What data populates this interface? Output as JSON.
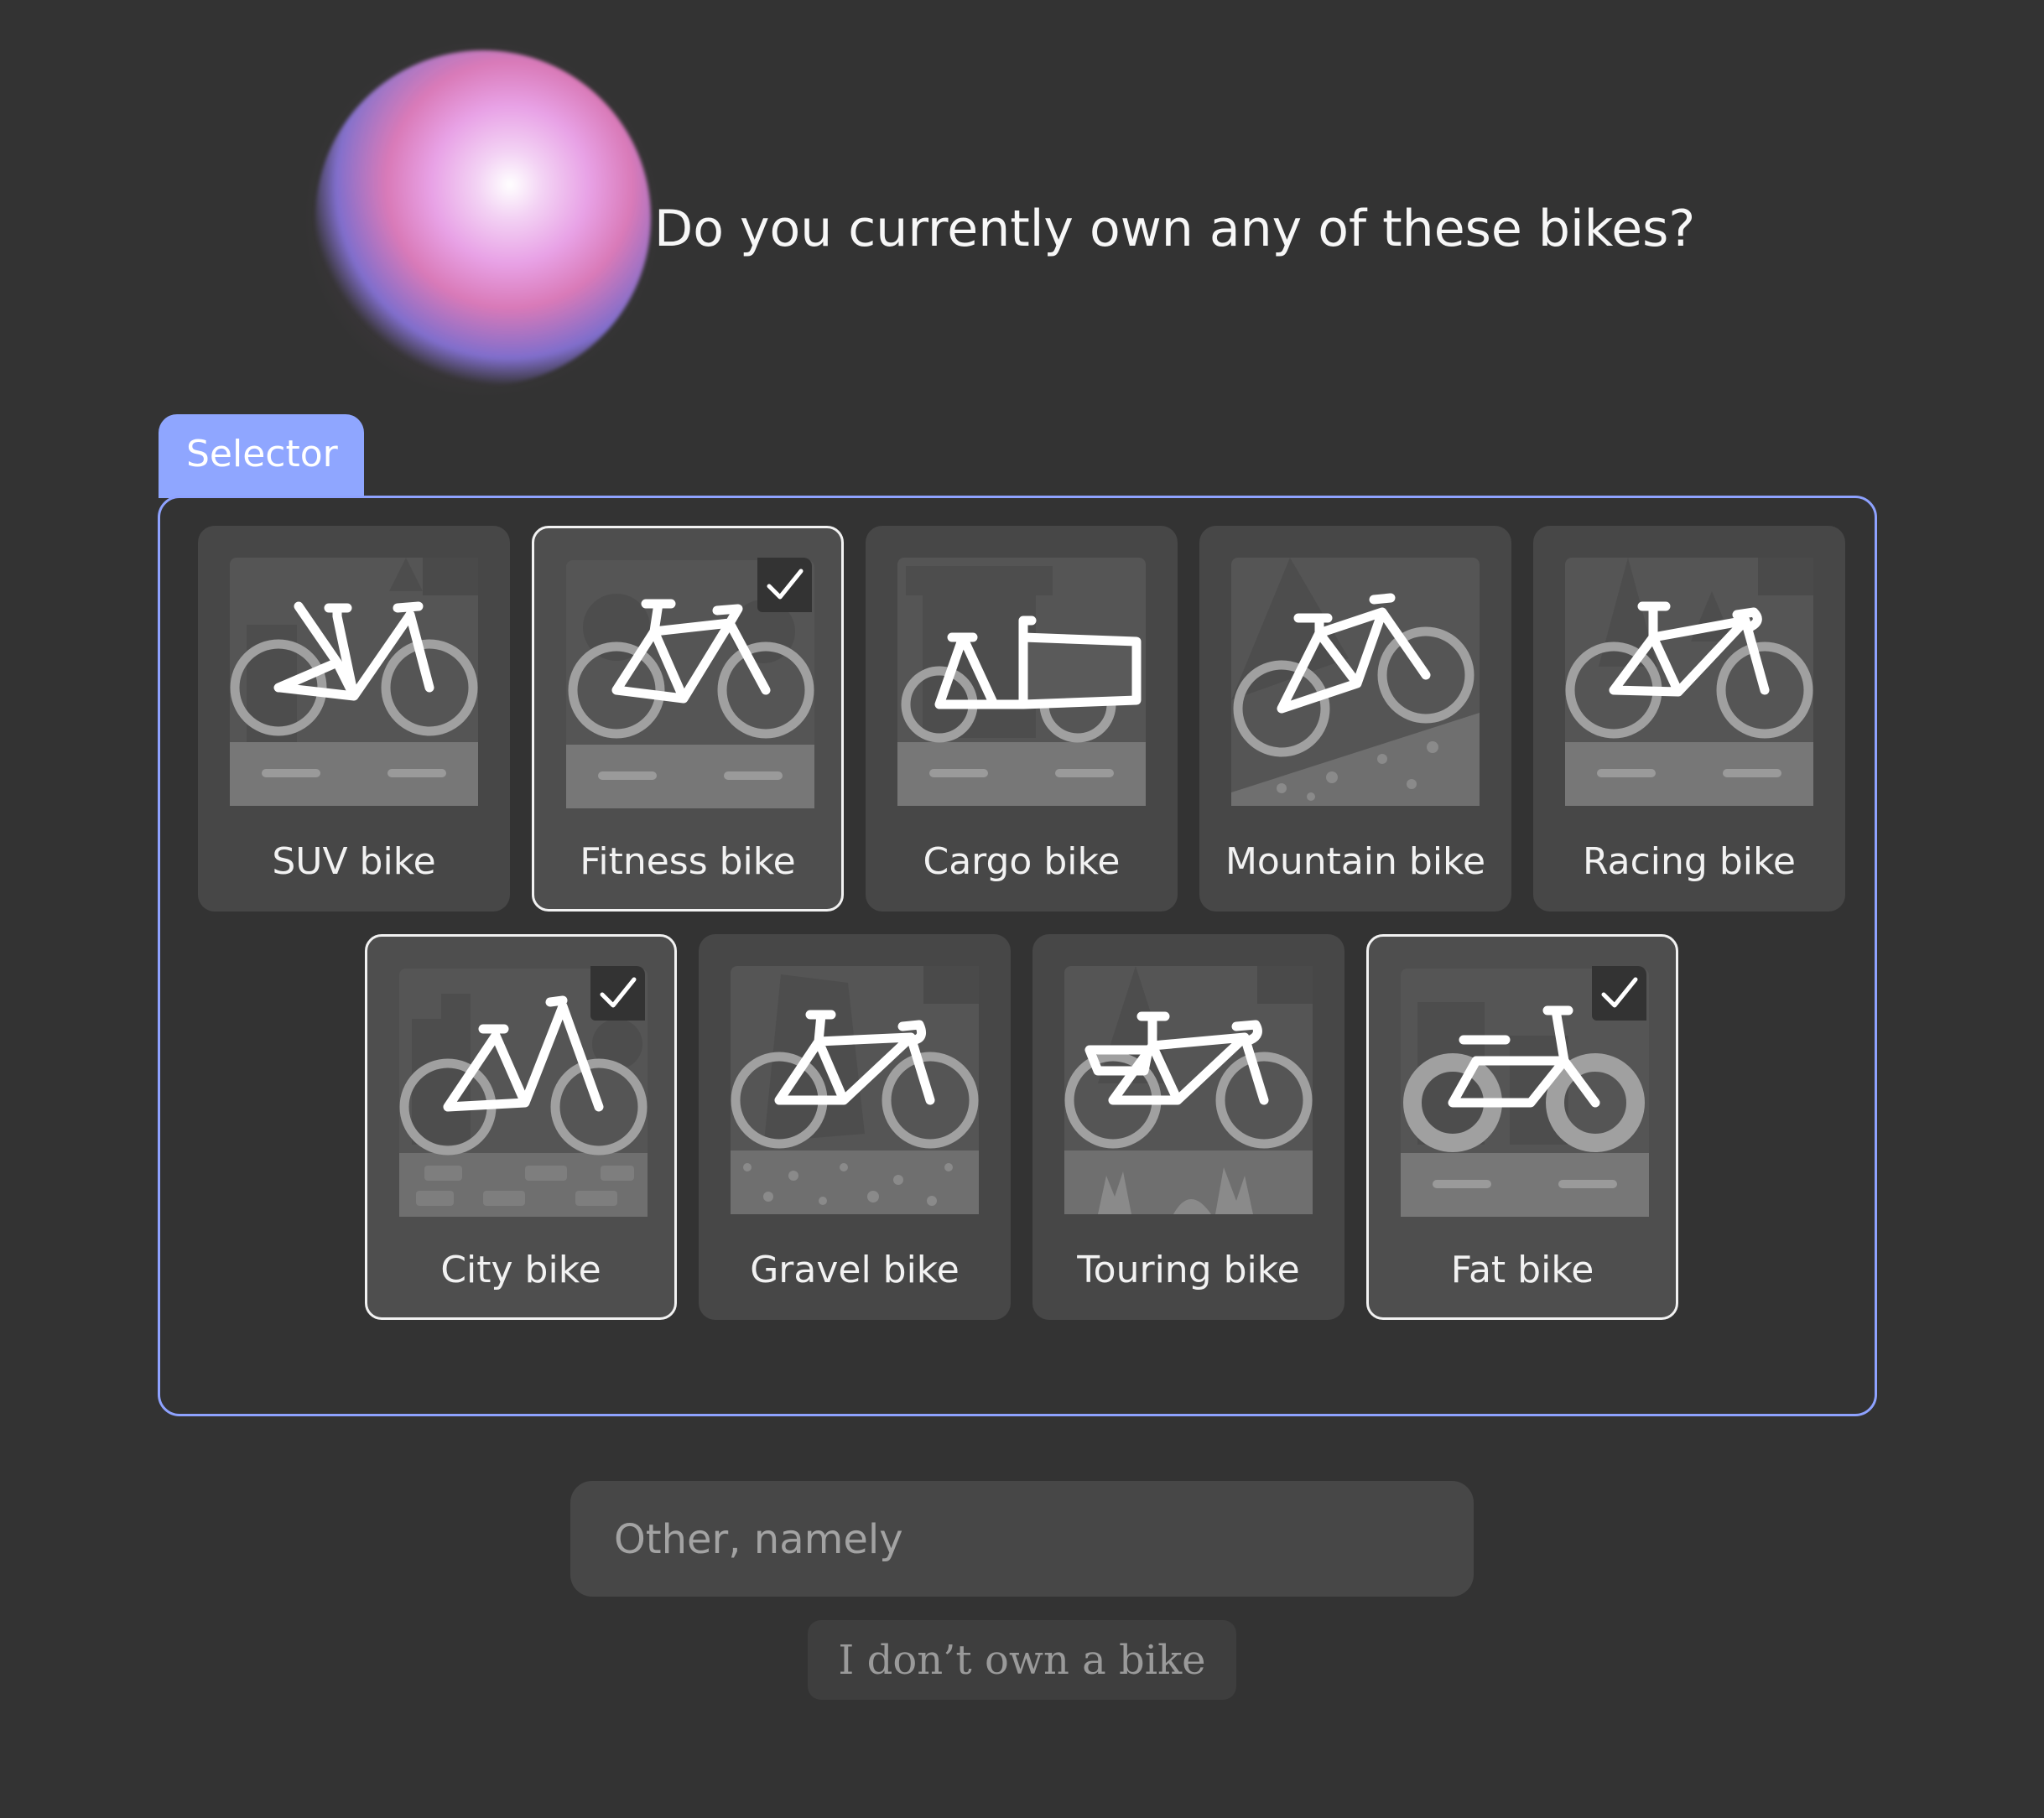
{
  "question": "Do you currently own any of these bikes?",
  "selector": {
    "tab_label": "Selector",
    "options": [
      {
        "label": "SUV bike",
        "selected": false,
        "icon": "suv-bike-icon"
      },
      {
        "label": "Fitness bike",
        "selected": true,
        "icon": "fitness-bike-icon"
      },
      {
        "label": "Cargo bike",
        "selected": false,
        "icon": "cargo-bike-icon"
      },
      {
        "label": "Mountain bike",
        "selected": false,
        "icon": "mountain-bike-icon"
      },
      {
        "label": "Racing bike",
        "selected": false,
        "icon": "racing-bike-icon"
      },
      {
        "label": "City bike",
        "selected": true,
        "icon": "city-bike-icon"
      },
      {
        "label": "Gravel bike",
        "selected": false,
        "icon": "gravel-bike-icon"
      },
      {
        "label": "Touring bike",
        "selected": false,
        "icon": "touring-bike-icon"
      },
      {
        "label": "Fat bike",
        "selected": true,
        "icon": "fat-bike-icon"
      }
    ]
  },
  "other_input": {
    "placeholder": "Other, namely",
    "value": ""
  },
  "no_bike_button": "I don’t own a bike",
  "colors": {
    "background": "#333333",
    "accent": "#8fa6ff",
    "card": "#474747",
    "selected_border": "#f2f2f2"
  }
}
